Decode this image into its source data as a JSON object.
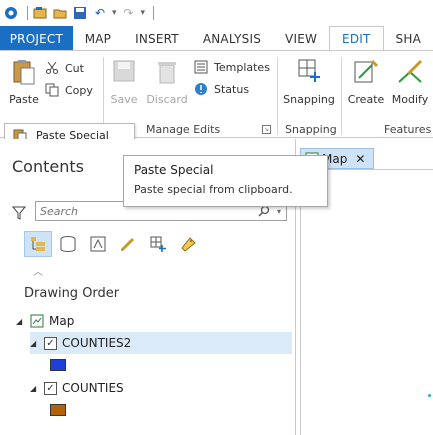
{
  "quick_access": {
    "undo_arrow": "↶",
    "redo_arrow": "↷"
  },
  "tabs": [
    "PROJECT",
    "MAP",
    "INSERT",
    "ANALYSIS",
    "VIEW",
    "EDIT",
    "SHA"
  ],
  "active_tab": "EDIT",
  "ribbon": {
    "clipboard": {
      "paste": "Paste",
      "cut": "Cut",
      "copy": "Copy"
    },
    "manage_edits": {
      "save": "Save",
      "discard": "Discard",
      "templates": "Templates",
      "status": "Status",
      "label": "Manage Edits"
    },
    "snapping": {
      "snapping": "Snapping",
      "label": "Snapping"
    },
    "features": {
      "create": "Create",
      "modify": "Modify",
      "label": "Features"
    }
  },
  "paste_special_item": "Paste Special",
  "tooltip": {
    "title": "Paste Special",
    "description": "Paste special from clipboard."
  },
  "contents": {
    "title": "Contents",
    "search_placeholder": "Search",
    "drawing_order": "Drawing Order",
    "tree": {
      "map_label": "Map",
      "layers": [
        {
          "name": "COUNTIES2",
          "checked": true,
          "swatch": "#1f3fd8",
          "selected": true
        },
        {
          "name": "COUNTIES",
          "checked": true,
          "swatch": "#b3620c",
          "selected": false
        }
      ]
    }
  },
  "map_tab": {
    "label": "Map",
    "close": "✕"
  },
  "colors": {
    "accent": "#1a6fc2",
    "selection": "#dbeaf8"
  }
}
